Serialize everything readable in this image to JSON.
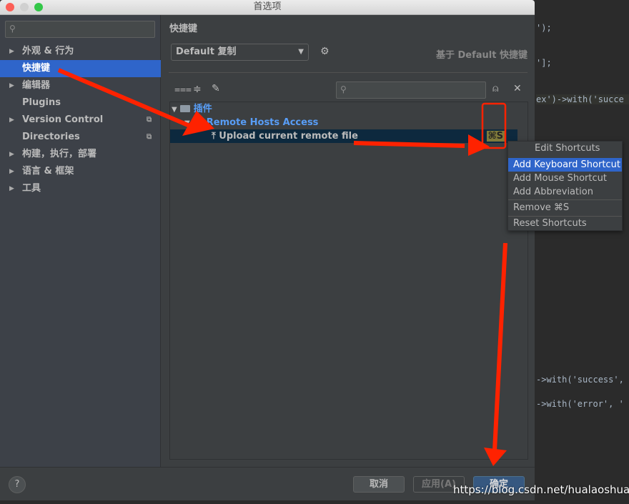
{
  "window": {
    "title": "首选项"
  },
  "sidebar": {
    "search_placeholder": "",
    "items": [
      {
        "label": "外观 & 行为",
        "expandable": true
      },
      {
        "label": "快捷键",
        "selected": true
      },
      {
        "label": "编辑器",
        "expandable": true
      },
      {
        "label": "Plugins"
      },
      {
        "label": "Version Control",
        "expandable": true,
        "project_icon": true
      },
      {
        "label": "Directories",
        "project_icon": true
      },
      {
        "label": "构建，执行，部署",
        "expandable": true
      },
      {
        "label": "语言 & 框架",
        "expandable": true
      },
      {
        "label": "工具",
        "expandable": true
      }
    ]
  },
  "main": {
    "title": "快捷键",
    "keymap": "Default 复制",
    "based_on": "基于 Default 快捷键",
    "tree": {
      "root": "插件",
      "group": "Remote Hosts Access",
      "action": "Upload current remote file",
      "shortcut": "⌘S"
    }
  },
  "context_menu": {
    "header": "Edit Shortcuts",
    "items": [
      "Add Keyboard Shortcut",
      "Add Mouse Shortcut",
      "Add Abbreviation",
      "Remove ⌘S",
      "Reset Shortcuts"
    ],
    "selected": "Add Keyboard Shortcut"
  },
  "footer": {
    "help": "?",
    "cancel": "取消",
    "apply": "应用(A)",
    "ok": "确定"
  },
  "editor": {
    "lines": [
      "');",
      "'];",
      "ex')->with('succe",
      "->with('success',",
      "->with('error', '"
    ]
  },
  "watermark": "https://blog.csdn.net/hualaoshuan",
  "colors": {
    "selection": "#2f65ca",
    "annotation": "#ff2200",
    "link": "#589df6"
  }
}
